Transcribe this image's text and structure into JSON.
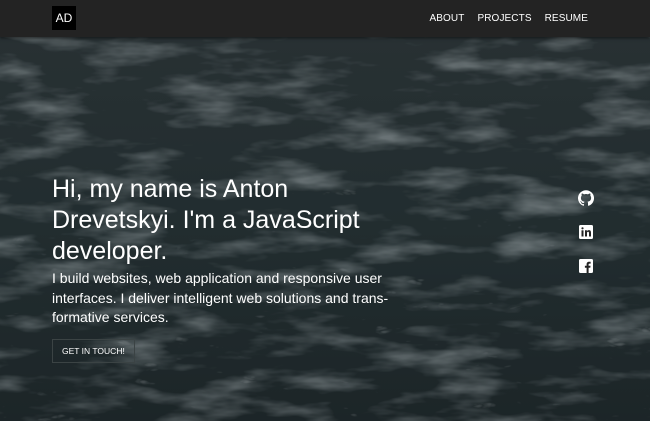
{
  "nav": {
    "logo": "AD",
    "links": [
      "ABOUT",
      "PROJECTS",
      "RESUME"
    ]
  },
  "hero": {
    "headline": "Hi, my name is Anton Drevetskyi. I'm a JavaScript developer.",
    "lead": "I build websites, web application and responsive user interfaces. I deliver intelligent web solutions and trans-formative services.",
    "cta": "GET IN TOUCH!"
  },
  "social": [
    {
      "icon": "github-icon"
    },
    {
      "icon": "linkedin-icon"
    },
    {
      "icon": "facebook-icon"
    }
  ],
  "colors": {
    "nav_background": "#232323",
    "logo_background": "#000000",
    "hero_overlay": "#1c2426",
    "text": "#ffffff"
  }
}
